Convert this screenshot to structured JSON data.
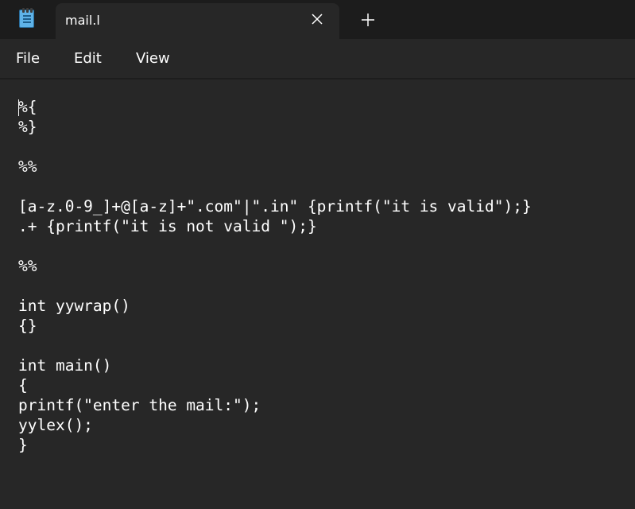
{
  "window": {
    "tab_title": "mail.l",
    "icons": {
      "app": "notepad-icon",
      "close": "close-icon",
      "new_tab": "plus-icon"
    }
  },
  "menu": {
    "items": [
      "File",
      "Edit",
      "View"
    ]
  },
  "editor": {
    "lines": [
      "%{",
      "%}",
      "",
      "%%",
      "",
      "[a-z.0-9_]+@[a-z]+\".com\"|\".in\" {printf(\"it is valid\");}",
      ".+ {printf(\"it is not valid \");}",
      "",
      "%%",
      "",
      "int yywrap()",
      "{}",
      "",
      "int main()",
      "{",
      "printf(\"enter the mail:\");",
      "yylex();",
      "}"
    ]
  },
  "colors": {
    "background": "#272727",
    "titlebar": "#1c1c1c",
    "text": "#ffffff",
    "icon_accent": "#5fb3e8"
  }
}
